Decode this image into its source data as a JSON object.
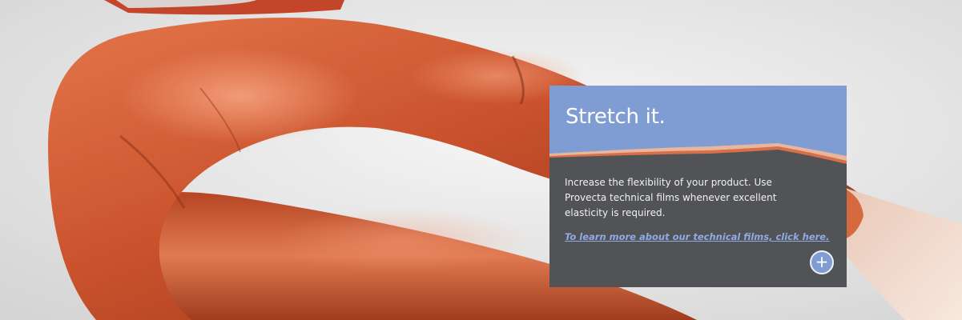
{
  "hero": {
    "image_description_icon": "legs-in-orange-leggings-image"
  },
  "card": {
    "title": "Stretch it.",
    "body": "Increase the flexibility of your product. Use Provecta technical films whenever excellent elasticity is required.",
    "link_text": "To learn more about our technical films, click here.",
    "more_button_label": "+",
    "colors": {
      "header": "#7f9dd3",
      "body": "#525356",
      "link": "#8fabe2"
    }
  }
}
